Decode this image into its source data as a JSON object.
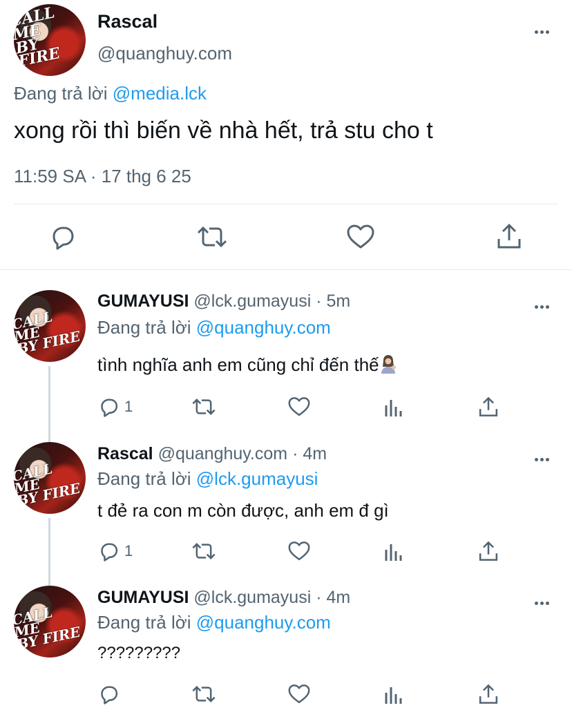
{
  "main_tweet": {
    "author_name": "Rascal",
    "handle": "@quanghuy.com",
    "replying_prefix": "Đang trả lời ",
    "replying_to": "@media.lck",
    "text": "xong rồi thì biến về nhà hết, trả stu cho t",
    "timestamp": "11:59 SA · 17 thg 6 25"
  },
  "replies": [
    {
      "author_name": "GUMAYUSI",
      "handle": "@lck.gumayusi",
      "time": "· 5m",
      "replying_prefix": "Đang trả lời ",
      "replying_to": "@quanghuy.com",
      "text": "tình nghĩa anh em cũng chỉ đến thế",
      "emoji": "woman-tipping-hand",
      "reply_count": "1"
    },
    {
      "author_name": "Rascal",
      "handle": "@quanghuy.com",
      "time": "· 4m",
      "replying_prefix": "Đang trả lời ",
      "replying_to": "@lck.gumayusi",
      "text": "t đẻ ra con m còn được, anh em đ gì",
      "reply_count": "1"
    },
    {
      "author_name": "GUMAYUSI",
      "handle": "@lck.gumayusi",
      "time": "· 4m",
      "replying_prefix": "Đang trả lời ",
      "replying_to": "@quanghuy.com",
      "text": "?????????",
      "reply_count": ""
    }
  ],
  "icons": [
    "more-icon",
    "reply-icon",
    "retweet-icon",
    "like-icon",
    "analytics-icon",
    "share-icon"
  ],
  "colors": {
    "link": "#1d9bf0",
    "muted": "#536471",
    "text": "#0f1419",
    "divider": "#e6ecf0"
  }
}
